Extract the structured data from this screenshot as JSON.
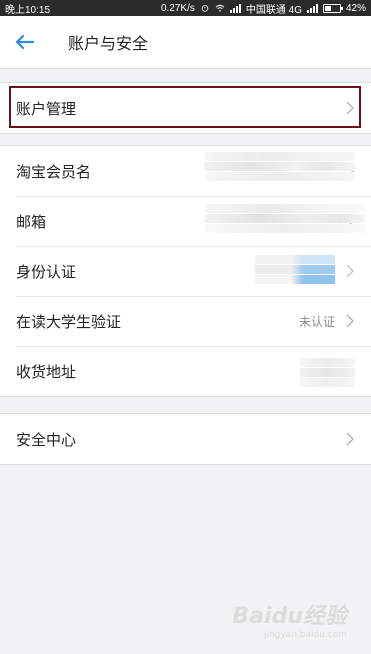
{
  "status_bar": {
    "time": "晚上10:15",
    "speed": "0.27K/s",
    "carrier": "中国联通 4G",
    "battery": "42%"
  },
  "header": {
    "title": "账户与安全",
    "back_icon": "back-arrow-icon"
  },
  "group1": {
    "items": [
      {
        "label": "账户管理"
      }
    ]
  },
  "group2": {
    "items": [
      {
        "label": "淘宝会员名"
      },
      {
        "label": "邮箱"
      },
      {
        "label": "身份认证"
      },
      {
        "label": "在读大学生验证",
        "value": "未认证"
      },
      {
        "label": "收货地址"
      }
    ]
  },
  "group3": {
    "items": [
      {
        "label": "安全中心"
      }
    ]
  },
  "watermark": {
    "text": "Baidu经验",
    "sub": "jingyan.baidu.com"
  },
  "colors": {
    "accent": "#2f8fd8",
    "highlight_border": "#6b1019"
  }
}
